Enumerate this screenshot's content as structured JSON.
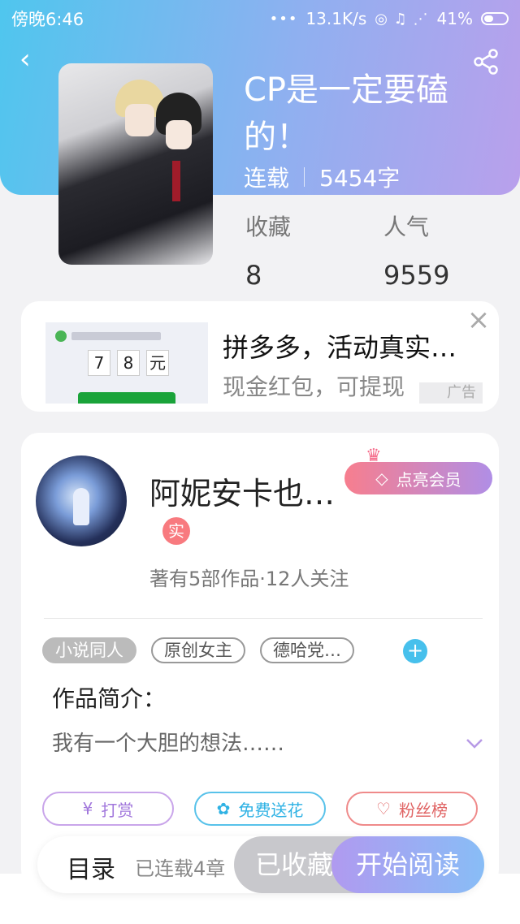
{
  "status_bar": {
    "time": "傍晚6:46",
    "speed": "13.1K/s",
    "battery": "41%"
  },
  "book": {
    "title": "CP是一定要磕的！",
    "status": "连载",
    "word_count": "5454字",
    "favorites_label": "收藏",
    "favorites_value": "8",
    "popularity_label": "人气",
    "popularity_value": "9559"
  },
  "ad": {
    "title": "拼多多，活动真实…",
    "subtitle": "现金红包，可提现",
    "tag": "广告",
    "image_amount": [
      "7",
      "8",
      "元"
    ]
  },
  "author": {
    "name": "阿妮安卡也…",
    "real_badge": "实",
    "vip_button": "点亮会员",
    "stats": "著有5部作品·12人关注"
  },
  "tags": [
    "小说同人",
    "原创女主",
    "德哈党…"
  ],
  "intro": {
    "label": "作品简介：",
    "text": "我有一个大胆的想法……"
  },
  "actions": {
    "reward": "打赏",
    "flower": "免费送花",
    "fans": "粉丝榜"
  },
  "bottom_bar": {
    "toc": "目录",
    "toc_count": "已连载4章",
    "collected": "已收藏",
    "read": "开始阅读"
  },
  "colors": {
    "header_start": "#4fc6ee",
    "header_end": "#b9a0ec",
    "accent_blue": "#47c0ec",
    "accent_purple": "#a278dc",
    "accent_red": "#e06464"
  }
}
